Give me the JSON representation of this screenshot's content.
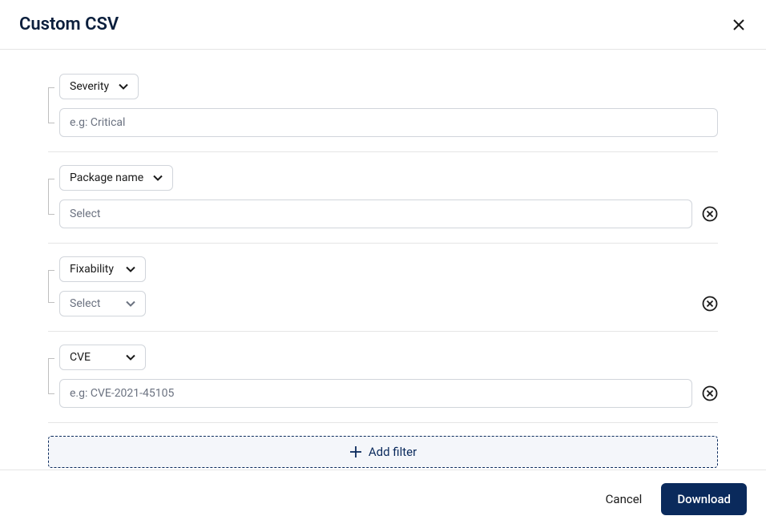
{
  "header": {
    "title": "Custom CSV"
  },
  "filters": {
    "severity": {
      "label": "Severity",
      "placeholder": "e.g: Critical"
    },
    "package_name": {
      "label": "Package name",
      "value_placeholder": "Select"
    },
    "fixability": {
      "label": "Fixability",
      "value_placeholder": "Select"
    },
    "cve": {
      "label": "CVE",
      "placeholder": "e.g: CVE-2021-45105"
    }
  },
  "add_filter_label": "Add filter",
  "footer": {
    "cancel_label": "Cancel",
    "download_label": "Download"
  }
}
